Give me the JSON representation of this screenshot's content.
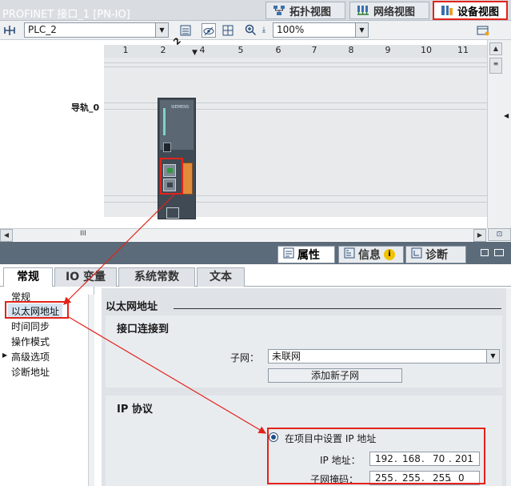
{
  "view_tabs": {
    "topology": "拓扑视图",
    "network": "网络视图",
    "device": "设备视图"
  },
  "toolbar": {
    "device_select": "PLC_2",
    "zoom": "100%"
  },
  "canvas": {
    "device_label": "PLC_2",
    "rail_label": "导轨_0",
    "slots": [
      "1",
      "2",
      "4",
      "5",
      "6",
      "7",
      "8",
      "9",
      "10",
      "11"
    ],
    "module_brand": "SIEMENS"
  },
  "scrollbar": {
    "thumb_glyph": "III"
  },
  "inspector": {
    "title": "PROFINET 接口_1 [PN-IO]",
    "tabs": {
      "properties": "属性",
      "info": "信息",
      "diagnostics": "诊断"
    }
  },
  "property_tabs": [
    "常规",
    "IO 变量",
    "系统常数",
    "文本"
  ],
  "nav": {
    "items": [
      "常规",
      "以太网地址",
      "时间同步",
      "操作模式",
      "高级选项",
      "诊断地址"
    ]
  },
  "content": {
    "heading": "以太网地址",
    "interface_section": "接口连接到",
    "subnet_label": "子网：",
    "subnet_value": "未联网",
    "add_subnet_button": "添加新子网",
    "ip_section": "IP 协议",
    "radio_label": "在项目中设置 IP 地址",
    "ip_label": "IP 地址：",
    "ip_octets": [
      "192",
      "168",
      "70",
      "201"
    ],
    "mask_label": "子网掩码：",
    "mask_octets": [
      "255",
      "255",
      "255",
      "0"
    ]
  },
  "colors": {
    "highlight": "#e2231a",
    "inspector_bar": "#5c6b7a",
    "section_bg": "#e9ecef"
  }
}
